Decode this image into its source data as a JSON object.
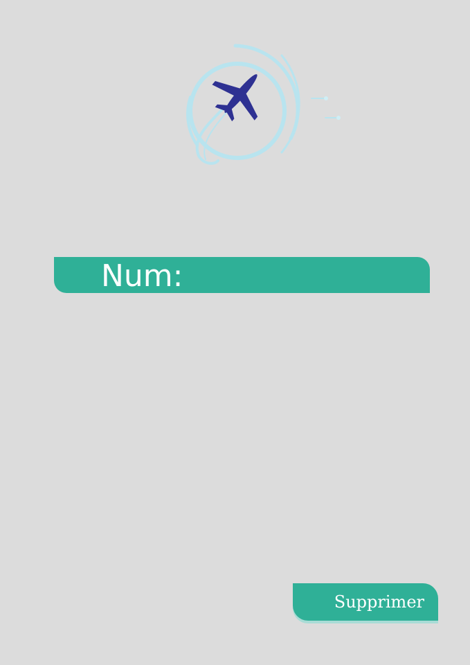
{
  "colors": {
    "background": "#dcdcdc",
    "accent": "#2fb097",
    "plane": "#2e3192",
    "rings": "#b8e4ef",
    "text_on_accent": "#ffffff"
  },
  "logo": {
    "icon": "airplane-icon"
  },
  "num_field": {
    "label": "Num:",
    "value": ""
  },
  "delete_button": {
    "label": "Supprimer"
  }
}
